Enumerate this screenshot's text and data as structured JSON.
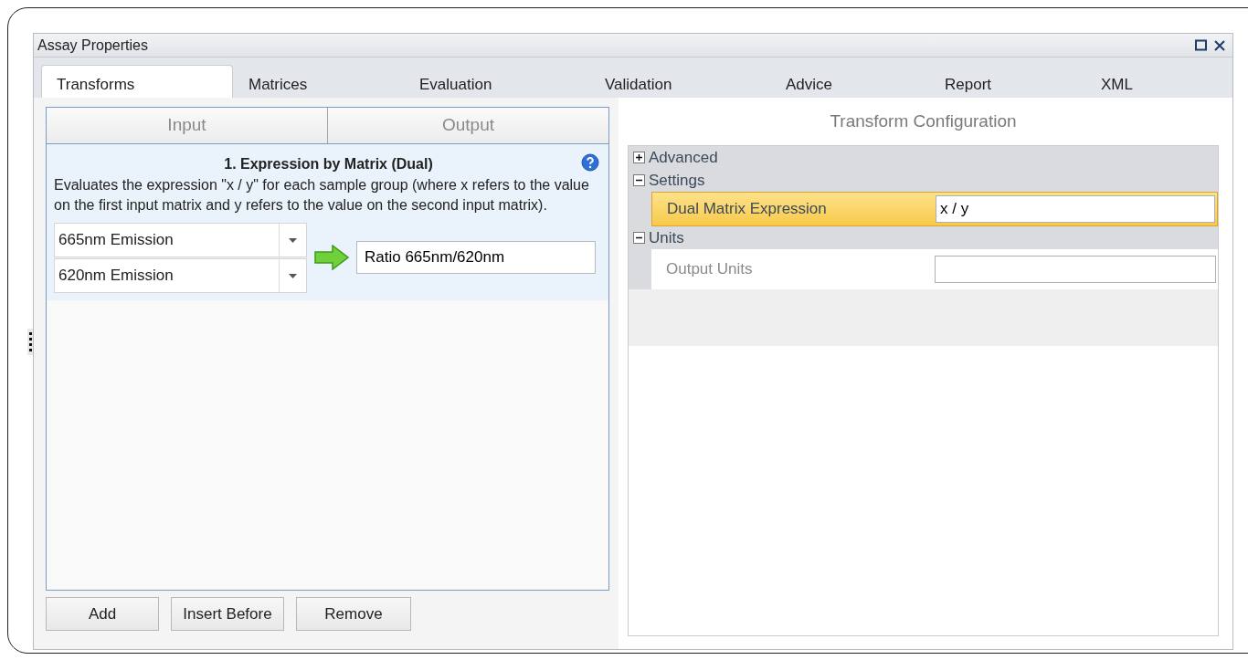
{
  "window": {
    "title": "Assay Properties"
  },
  "tabs": [
    {
      "label": "Transforms",
      "selected": true
    },
    {
      "label": "Matrices",
      "selected": false
    },
    {
      "label": "Evaluation",
      "selected": false
    },
    {
      "label": "Validation",
      "selected": false
    },
    {
      "label": "Advice",
      "selected": false
    },
    {
      "label": "Report",
      "selected": false
    },
    {
      "label": "XML",
      "selected": false
    }
  ],
  "transform_list": {
    "columns": [
      "Input",
      "Output"
    ],
    "items": [
      {
        "title": "1. Expression by Matrix (Dual)",
        "description": "Evaluates the expression \"x / y\" for each sample group (where x refers to the value on the first input matrix and y refers to the value on the second input matrix).",
        "inputs": [
          "665nm Emission",
          "620nm Emission"
        ],
        "output": "Ratio 665nm/620nm",
        "selected": true
      }
    ]
  },
  "buttons": [
    "Add",
    "Insert Before",
    "Remove"
  ],
  "configuration": {
    "title": "Transform Configuration",
    "categories": [
      {
        "label": "Advanced",
        "expanded": false
      },
      {
        "label": "Settings",
        "expanded": true,
        "properties": [
          {
            "label": "Dual Matrix Expression",
            "value": "x / y",
            "selected": true
          }
        ]
      },
      {
        "label": "Units",
        "expanded": true,
        "properties": [
          {
            "label": "Output Units",
            "selected": false
          }
        ]
      }
    ]
  }
}
